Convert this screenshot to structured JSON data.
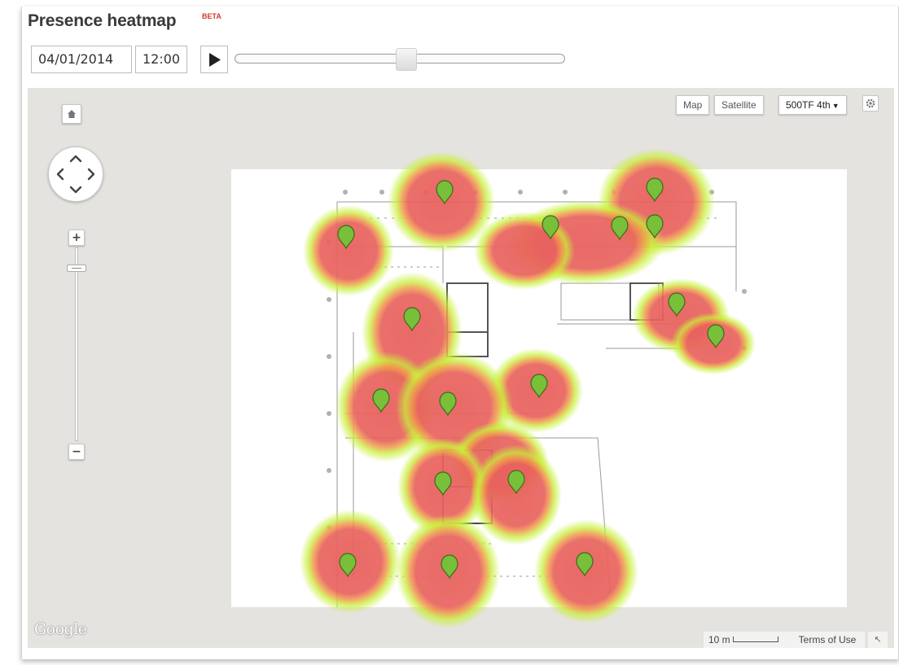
{
  "widget": {
    "title": "Presence heatmap",
    "badge": "BETA"
  },
  "controls": {
    "date_value": "04/01/2014",
    "time_value": "12:00",
    "play_icon": "play-icon",
    "timeline_position": 0.5
  },
  "map": {
    "type_buttons": [
      "Map",
      "Satellite"
    ],
    "floor_select": "500TF 4th",
    "settings_icon": "gear-icon",
    "home_icon": "home-icon",
    "zoom_in_label": "+",
    "zoom_out_label": "−",
    "logo": "Google",
    "scale_label": "10 m",
    "terms_label": "Terms of Use",
    "expand_icon": "expand-arrow-icon"
  },
  "colors": {
    "heat_core": "#e8625e",
    "heat_edge": "#c8ef3a",
    "marker": "#78bf3a",
    "map_background": "#e5e3df"
  }
}
